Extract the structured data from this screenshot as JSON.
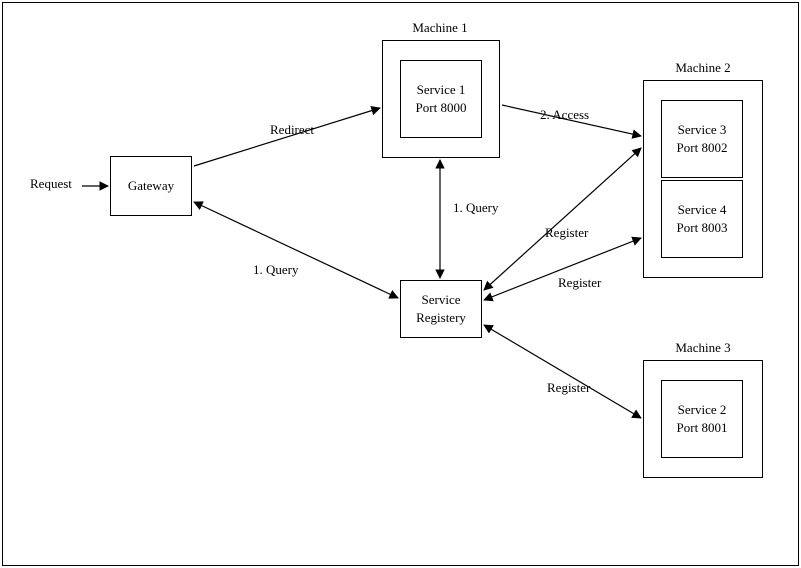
{
  "labels": {
    "request": "Request",
    "redirect": "Redirect",
    "access": "2. Access",
    "query_top": "1. Query",
    "query_left": "1. Query",
    "register1": "Register",
    "register2": "Register",
    "register3": "Register"
  },
  "nodes": {
    "gateway": "Gateway",
    "service1_line1": "Service 1",
    "service1_line2": "Port 8000",
    "service3_line1": "Service 3",
    "service3_line2": "Port 8002",
    "service4_line1": "Service 4",
    "service4_line2": "Port 8003",
    "service2_line1": "Service 2",
    "service2_line2": "Port 8001",
    "registry_line1": "Service",
    "registry_line2": "Registery"
  },
  "machines": {
    "m1": "Machine 1",
    "m2": "Machine 2",
    "m3": "Machine 3"
  }
}
